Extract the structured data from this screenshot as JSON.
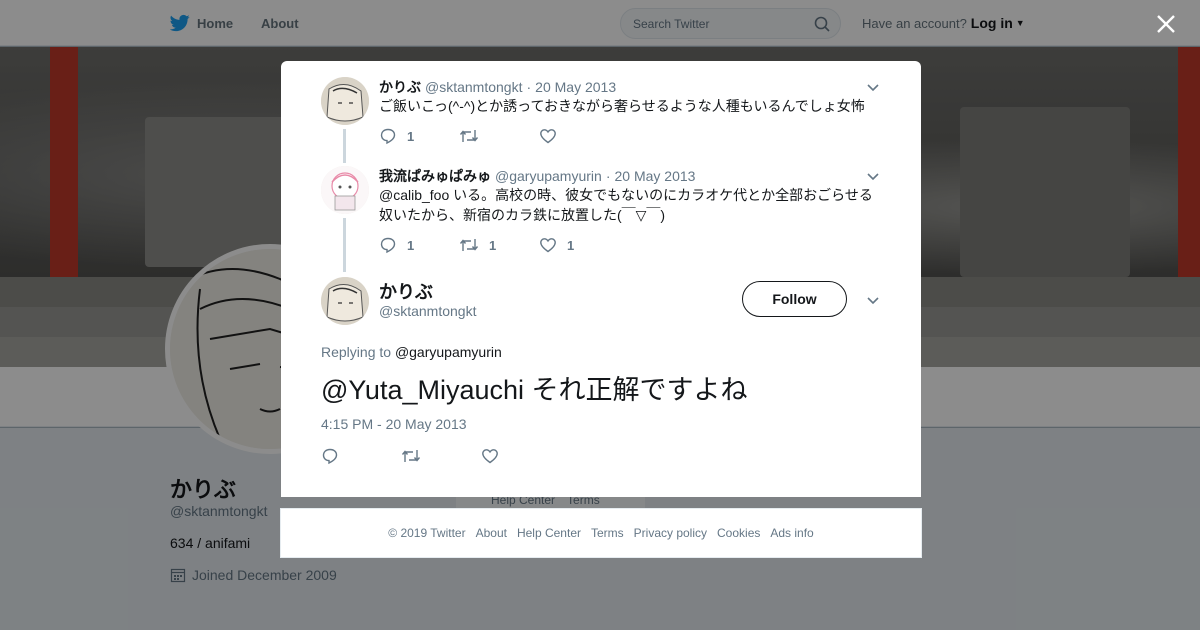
{
  "topbar": {
    "home_label": "Home",
    "about_label": "About",
    "search_placeholder": "Search Twitter",
    "account_prompt": "Have an account?",
    "login_label": "Log in"
  },
  "profile": {
    "name": "かりぶ",
    "handle": "@sktanmtongkt",
    "bio": "634 / anifami",
    "joined": "Joined December 2009",
    "sidebar_links": [
      "Help Center",
      "Terms"
    ]
  },
  "thread": [
    {
      "name": "かりぶ",
      "handle": "@sktanmtongkt",
      "date": "20 May 2013",
      "text_lines": [
        "ご飯いこっ(^-^)とか誘っておきながら奢らせるような人種もいるんでしょ女怖"
      ],
      "replies": "1",
      "retweets": "",
      "likes": ""
    },
    {
      "name": "我流ぱみゅぱみゅ",
      "handle": "@garyupamyurin",
      "date": "20 May 2013",
      "text_lines": [
        "@calib_foo いる。高校の時、彼女でもないのにカラオケ代とか全部おごらせる",
        "奴いたから、新宿のカラ鉄に放置した(￣▽￣)"
      ],
      "replies": "1",
      "retweets": "1",
      "likes": "1"
    }
  ],
  "main_tweet": {
    "name": "かりぶ",
    "handle": "@sktanmtongkt",
    "follow_label": "Follow",
    "replying_prefix": "Replying to",
    "replying_to": "@garyupamyurin",
    "text": "@Yuta_Miyauchi それ正解ですよね",
    "timestamp": "4:15 PM - 20 May 2013"
  },
  "footer": {
    "links": [
      "© 2019 Twitter",
      "About",
      "Help Center",
      "Terms",
      "Privacy policy",
      "Cookies",
      "Ads info"
    ]
  },
  "colors": {
    "twitter_blue": "#1da1f2",
    "text_primary": "#14171a",
    "text_secondary": "#657786"
  }
}
